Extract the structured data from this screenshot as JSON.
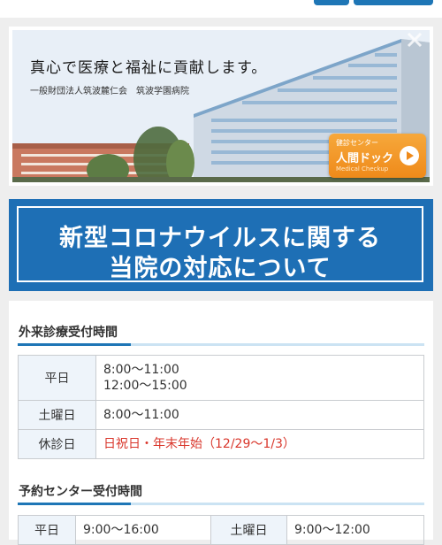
{
  "hero": {
    "title": "真心で医療と福祉に貢献します。",
    "subtitle": "一般財団法人筑波麓仁会　筑波学園病院",
    "checkup": {
      "small_label": "健診センター",
      "main_label": "人間ドック",
      "en_label": "Medical Checkup",
      "icon": "play-icon"
    }
  },
  "covid_banner": {
    "line1": "新型コロナウイルスに関する",
    "line2": "当院の対応について"
  },
  "outpatient": {
    "title": "外来診療受付時間",
    "rows": [
      {
        "day": "平日",
        "time1": "8:00～11:00",
        "time2": "12:00～15:00"
      },
      {
        "day": "土曜日",
        "time1": "8:00～11:00"
      },
      {
        "day": "休診日",
        "time1": "日祝日・年末年始（12/29～1/3）"
      }
    ]
  },
  "reservation": {
    "title": "予約センター受付時間",
    "rows": [
      {
        "day": "平日",
        "time": "9:00～16:00",
        "day2": "土曜日",
        "time2": "9:00～12:00"
      }
    ]
  },
  "colors": {
    "primary_blue": "#1e76b6",
    "banner_blue": "#1e6fb5",
    "accent_orange": "#ef8a1a",
    "closed_red": "#d9362b"
  }
}
